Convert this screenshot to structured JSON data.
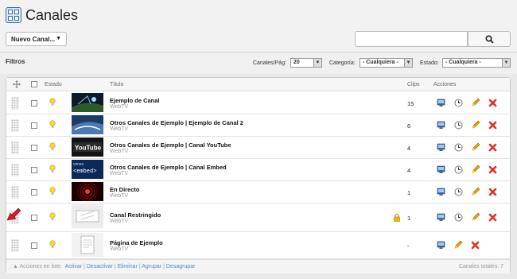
{
  "app": {
    "title": "Canales"
  },
  "toolbar": {
    "new_button": "Nuevo Canal...",
    "search_placeholder": ""
  },
  "filters": {
    "label": "Filtros",
    "per_page_label": "Canales/Pág:",
    "per_page_value": "20",
    "category_label": "Categoría:",
    "category_value": "- Cualquiera -",
    "status_label": "Estado:",
    "status_value": "- Cualquiera -"
  },
  "table": {
    "columns": {
      "status": "Estado",
      "title": "Título",
      "clips": "Clips",
      "actions": "Acciones"
    },
    "rows": [
      {
        "title": "Ejemplo de Canal",
        "sub": "WebTV",
        "clips": "15"
      },
      {
        "title": "Otros Canales de Ejemplo | Ejemplo de Canal 2",
        "sub": "WebTV",
        "clips": "6"
      },
      {
        "title": "Otros Canales de Ejemplo | Canal YouTube",
        "sub": "WebTV",
        "clips": "4",
        "thumb_text": "YouTube"
      },
      {
        "title": "Otros Canales de Ejemplo | Canal Embed",
        "sub": "WebTV",
        "clips": "4",
        "thumb_text": "<embed>",
        "thumb_text2": "vimeo"
      },
      {
        "title": "En Directo",
        "sub": "WebTV",
        "clips": "1"
      },
      {
        "title": "Canal Restringido",
        "sub": "WebTV",
        "clips": "1"
      },
      {
        "title": "Página de Ejemplo",
        "sub": "WebTV",
        "clips": "-"
      }
    ]
  },
  "footer": {
    "bulk_label": "Acciones en lote:",
    "activate": "Activar",
    "deactivate": "Desactivar",
    "delete": "Eliminar",
    "group": "Agrupar",
    "ungroup": "Desagrupar",
    "total": "Canales totales: 7"
  },
  "colors": {
    "accent": "#3a6ea5",
    "link": "#5a8ac6",
    "delete": "#e03020",
    "edit": "#f0a000"
  }
}
